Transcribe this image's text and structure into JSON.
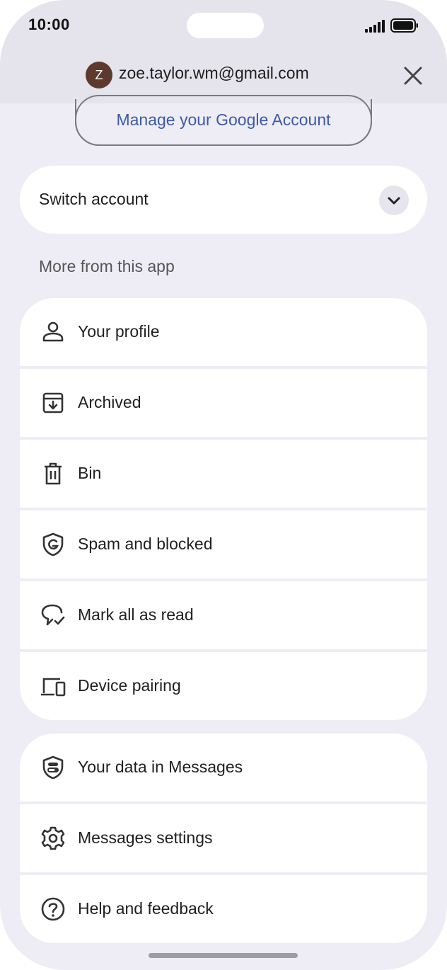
{
  "status": {
    "time": "10:00"
  },
  "account": {
    "avatar_letter": "Z",
    "email": "zoe.taylor.wm@gmail.com"
  },
  "manage_label": "Manage your Google Account",
  "switch_label": "Switch account",
  "section_title": "More from this app",
  "menu1": [
    {
      "label": "Your profile",
      "icon": "person-icon"
    },
    {
      "label": "Archived",
      "icon": "archive-icon"
    },
    {
      "label": "Bin",
      "icon": "trash-icon"
    },
    {
      "label": "Spam and blocked",
      "icon": "shield-g-icon"
    },
    {
      "label": "Mark all as read",
      "icon": "chat-check-icon"
    },
    {
      "label": "Device pairing",
      "icon": "devices-icon"
    }
  ],
  "menu2": [
    {
      "label": "Your data in Messages",
      "icon": "shield-toggle-icon"
    },
    {
      "label": "Messages settings",
      "icon": "gear-icon"
    },
    {
      "label": "Help and feedback",
      "icon": "help-icon"
    }
  ],
  "colors": {
    "link": "#3d5aa8",
    "background": "#eeedf5",
    "header": "#e5e4ec",
    "avatar": "#5d3a2d"
  }
}
